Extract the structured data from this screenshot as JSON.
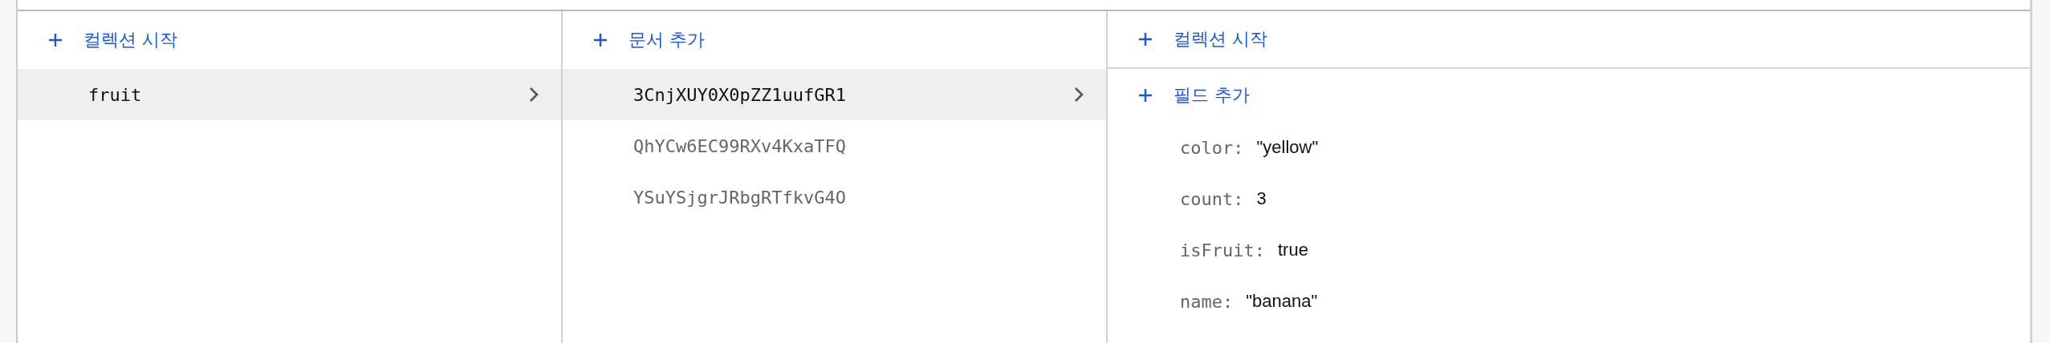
{
  "collections": {
    "action": {
      "label": "컬렉션 시작"
    },
    "items": [
      {
        "label": "fruit",
        "selected": true
      }
    ]
  },
  "documents": {
    "action": {
      "label": "문서 추가"
    },
    "items": [
      {
        "label": "3CnjXUY0X0pZZ1uufGR1",
        "selected": true
      },
      {
        "label": "QhYCw6EC99RXv4KxaTFQ",
        "selected": false
      },
      {
        "label": "YSuYSjgrJRbgRTfkvG4O",
        "selected": false
      }
    ]
  },
  "document": {
    "actions": [
      {
        "label": "컬렉션 시작"
      },
      {
        "label": "필드 추가"
      }
    ],
    "fields": [
      {
        "key": "color:",
        "value": "\"yellow\""
      },
      {
        "key": "count:",
        "value": "3"
      },
      {
        "key": "isFruit:",
        "value": "true"
      },
      {
        "key": "name:",
        "value": "\"banana\""
      }
    ]
  }
}
